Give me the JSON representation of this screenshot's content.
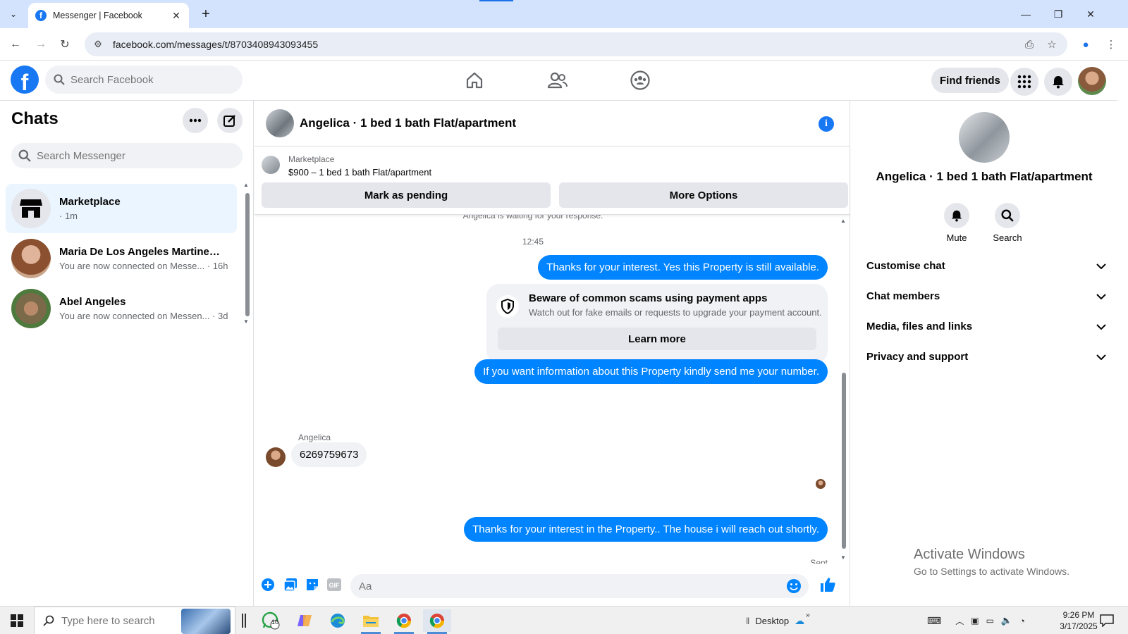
{
  "browser": {
    "tab_title": "Messenger | Facebook",
    "url": "facebook.com/messages/t/8703408943093455"
  },
  "header": {
    "search_placeholder": "Search Facebook",
    "find_friends": "Find friends"
  },
  "sidebar": {
    "title": "Chats",
    "search_placeholder": "Search Messenger",
    "chats": [
      {
        "name": "Marketplace",
        "sub": "· 1m"
      },
      {
        "name": "Maria De Los Angeles Martinez ...",
        "sub": "You are now connected on Messe... · 16h"
      },
      {
        "name": "Abel Angeles",
        "sub": "You are now connected on Messen... · 3d"
      }
    ]
  },
  "conversation": {
    "title": "Angelica · 1 bed 1 bath Flat/apartment",
    "marketplace": {
      "label": "Marketplace",
      "price": "$900 – 1 bed 1 bath Flat/apartment",
      "mark_pending": "Mark as pending",
      "more_options": "More Options"
    },
    "waiting": "Angelica is waiting for your response.",
    "time": "12:45",
    "msg1": "Thanks for your interest. Yes this Property is still available.",
    "scam": {
      "title": "Beware of common scams using payment apps",
      "sub": "Watch out for fake emails or requests to upgrade your payment account.",
      "learn_more": "Learn more"
    },
    "msg2": "If you want information about this Property kindly send me your number.",
    "sender": "Angelica",
    "incoming": "6269759673",
    "msg3": "Thanks for your interest in the Property.. The house i will reach  out shortly.",
    "sent": "Sent",
    "composer_placeholder": "Aa"
  },
  "rpanel": {
    "title": "Angelica · 1 bed 1 bath Flat/apartment",
    "mute": "Mute",
    "search": "Search",
    "sections": [
      "Customise chat",
      "Chat members",
      "Media, files and links",
      "Privacy and support"
    ]
  },
  "watermark": {
    "line1": "Activate Windows",
    "line2": "Go to Settings to activate Windows."
  },
  "taskbar": {
    "search_placeholder": "Type here to search",
    "whatsapp_badge": "10",
    "desktop": "Desktop",
    "time": "9:26 PM",
    "date": "3/17/2025"
  },
  "colors": {
    "brand": "#1877f2",
    "outgoing_bubble": "#0084ff",
    "active_chat": "#ebf5ff"
  }
}
